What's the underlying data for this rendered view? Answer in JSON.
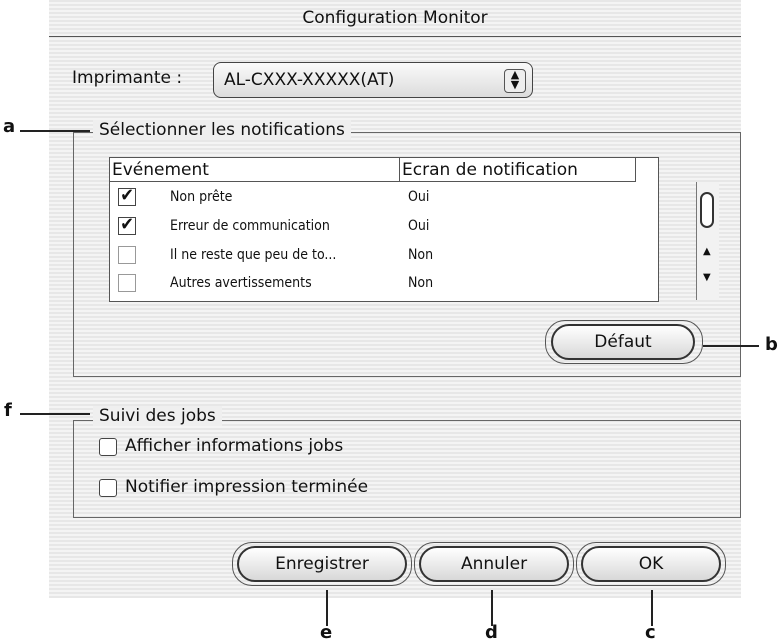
{
  "window": {
    "title": "Configuration Monitor"
  },
  "printer": {
    "label": "Imprimante :",
    "value": "AL-CXXX-XXXXX(AT)"
  },
  "notifications": {
    "group_title": "Sélectionner les notifications",
    "columns": [
      "Evénement",
      "Ecran de notification"
    ],
    "rows": [
      {
        "event": "Non prête",
        "screen": "Oui",
        "checked": "✔"
      },
      {
        "event": "Erreur de communication",
        "screen": "Oui",
        "checked": "✔"
      },
      {
        "event": "Il ne reste que peu de to...",
        "screen": "Non",
        "checked": ""
      },
      {
        "event": "Autres avertissements",
        "screen": "Non",
        "checked": ""
      }
    ],
    "default_button": "Défaut"
  },
  "jobs": {
    "group_title": "Suivi des jobs",
    "options": [
      "Afficher informations jobs",
      "Notifier impression terminée"
    ]
  },
  "buttons": {
    "save": "Enregistrer",
    "cancel": "Annuler",
    "ok": "OK"
  },
  "callouts": {
    "a": "a",
    "b": "b",
    "c": "c",
    "d": "d",
    "e": "e",
    "f": "f"
  },
  "icons": {
    "checkmark": "check-icon",
    "popup_arrows": "updown-arrows-icon"
  }
}
